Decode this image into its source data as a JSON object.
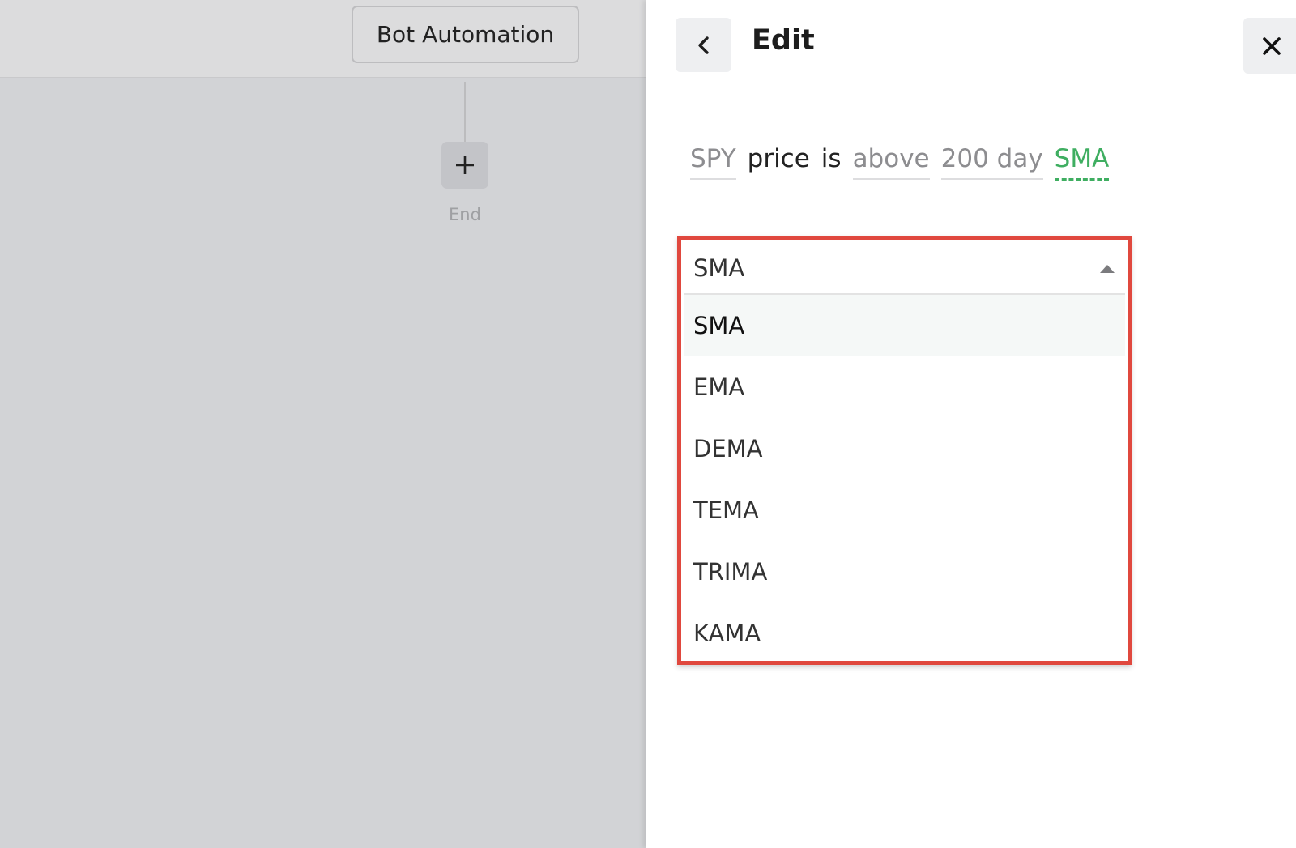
{
  "canvas": {
    "bot_node_label": "Bot Automation",
    "end_label": "End",
    "add_step_icon": "plus-icon"
  },
  "panel": {
    "title": "Edit",
    "back_icon": "chevron-left-icon",
    "close_icon": "close-icon"
  },
  "condition": {
    "ticker": "SPY",
    "word_price": "price",
    "word_is": "is",
    "comparator": "above",
    "period": "200 day",
    "indicator": "SMA"
  },
  "dropdown": {
    "selected_value": "SMA",
    "caret_icon": "caret-up-icon",
    "options": [
      {
        "label": "SMA"
      },
      {
        "label": "EMA"
      },
      {
        "label": "DEMA"
      },
      {
        "label": "TEMA"
      },
      {
        "label": "TRIMA"
      },
      {
        "label": "KAMA"
      }
    ]
  },
  "colors": {
    "highlight_border": "#e0483e",
    "active_token": "#3fae61",
    "canvas_background": "#d2d3d6"
  }
}
